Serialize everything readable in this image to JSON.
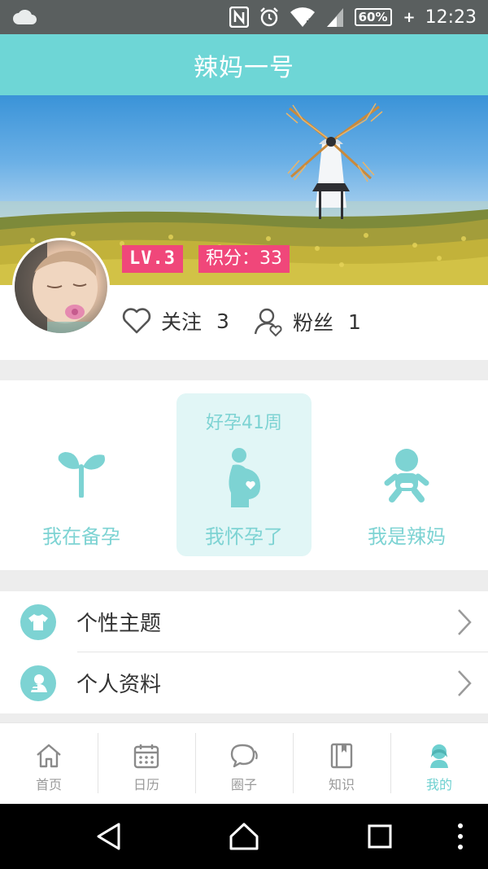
{
  "status_bar": {
    "time": "12:23",
    "battery": "60%",
    "icons": [
      "cloud-icon",
      "nfc-icon",
      "alarm-icon",
      "wifi-icon",
      "signal-icon",
      "battery-icon"
    ]
  },
  "header": {
    "title": "辣妈一号"
  },
  "profile": {
    "level": "LV.3",
    "points": "积分：33",
    "follow": {
      "label": "关注",
      "count": "3",
      "icon": "heart-icon"
    },
    "fans": {
      "label": "粉丝",
      "count": "1",
      "icon": "user-heart-icon"
    }
  },
  "stages": [
    {
      "label": "我在备孕",
      "icon": "sprout-icon",
      "active": false
    },
    {
      "label": "我怀孕了",
      "sublabel": "好孕41周",
      "icon": "pregnant-icon",
      "active": true
    },
    {
      "label": "我是辣妈",
      "icon": "baby-icon",
      "active": false
    }
  ],
  "menu": [
    {
      "label": "个性主题",
      "icon": "tshirt-icon"
    },
    {
      "label": "个人资料",
      "icon": "profile-icon"
    }
  ],
  "tabs": [
    {
      "label": "首页",
      "icon": "home-icon"
    },
    {
      "label": "日历",
      "icon": "calendar-icon"
    },
    {
      "label": "圈子",
      "icon": "chat-icon"
    },
    {
      "label": "知识",
      "icon": "book-icon"
    },
    {
      "label": "我的",
      "icon": "mine-icon",
      "active": true
    }
  ],
  "colors": {
    "accent": "#6ed6d6",
    "badge": "#f0477a",
    "stage_text": "#7dd3d3",
    "status_bar": "#5a5f5f"
  }
}
